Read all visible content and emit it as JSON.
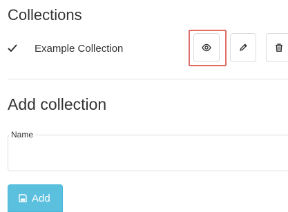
{
  "collections": {
    "title": "Collections",
    "items": [
      {
        "name": "Example Collection",
        "selected": true
      }
    ],
    "actions": {
      "view_icon": "eye-icon",
      "edit_icon": "pencil-icon",
      "delete_icon": "trash-icon"
    },
    "highlight_color": "#d9534f"
  },
  "add_collection": {
    "title": "Add collection",
    "name_field": {
      "label": "Name",
      "value": "",
      "placeholder": ""
    },
    "add_button": {
      "label": "Add",
      "icon": "save-icon",
      "color": "#5bc0de"
    }
  }
}
